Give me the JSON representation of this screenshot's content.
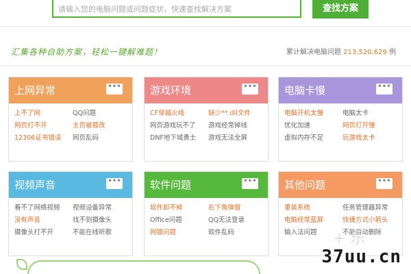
{
  "search": {
    "placeholder": "请输入您的电脑问题或问题症状，快速查找解决方案",
    "button_label": "查找方案"
  },
  "slogan": "汇集各种自助方案，轻松一键解难题！",
  "stats": {
    "prefix": "累计解决电脑问题",
    "count": "213,520,629",
    "suffix": "例"
  },
  "colors": {
    "orange": "#f0a25a",
    "pink": "#ee8787",
    "purple": "#a995dc",
    "blue": "#59b9e0",
    "green": "#55b93c",
    "salmon": "#f49a62",
    "highlight": "#e8702a"
  },
  "cards": [
    {
      "title": "上网异常",
      "more": "•••",
      "rows": [
        [
          {
            "t": "上不了网",
            "h": true
          },
          {
            "t": "QQ问题",
            "h": false
          }
        ],
        [
          {
            "t": "网页打不开",
            "h": true
          },
          {
            "t": "主页被篡改",
            "h": true
          }
        ],
        [
          {
            "t": "12306证书错误",
            "h": true
          },
          {
            "t": "网页乱码",
            "h": false
          }
        ]
      ]
    },
    {
      "title": "游戏环境",
      "more": "•••",
      "rows": [
        [
          {
            "t": "CF穿越火线",
            "h": true
          },
          {
            "t": "缺少**.dll文件",
            "h": true
          }
        ],
        [
          {
            "t": "网页游戏玩不了",
            "h": false
          },
          {
            "t": "游戏经常掉线",
            "h": false
          }
        ],
        [
          {
            "t": "DNF地下城勇士",
            "h": false
          },
          {
            "t": "游戏无法全屏",
            "h": false
          }
        ]
      ]
    },
    {
      "title": "电脑卡慢",
      "more": "•••",
      "rows": [
        [
          {
            "t": "电脑开机太慢",
            "h": true
          },
          {
            "t": "电脑太卡",
            "h": false
          }
        ],
        [
          {
            "t": "优化加速",
            "h": false
          },
          {
            "t": "网页打开慢",
            "h": true
          }
        ],
        [
          {
            "t": "虚拟内存不足",
            "h": false
          },
          {
            "t": "玩游戏太卡",
            "h": true
          }
        ]
      ]
    },
    {
      "title": "视频声音",
      "more": "•••",
      "rows": [
        [
          {
            "t": "看不了网络视频",
            "h": false
          },
          {
            "t": "视频设备异常",
            "h": false
          }
        ],
        [
          {
            "t": "没有声音",
            "h": true
          },
          {
            "t": "找不到摄像头",
            "h": false
          }
        ],
        [
          {
            "t": "摄像头打不开",
            "h": false
          },
          {
            "t": "不能在线听歌",
            "h": false
          }
        ]
      ]
    },
    {
      "title": "软件问题",
      "more": "•••",
      "rows": [
        [
          {
            "t": "软件卸不掉",
            "h": true
          },
          {
            "t": "右下角弹窗",
            "h": true
          }
        ],
        [
          {
            "t": "Office问题",
            "h": false
          },
          {
            "t": "QQ无法登录",
            "h": false
          }
        ],
        [
          {
            "t": "网银问题",
            "h": true
          },
          {
            "t": "软件乱码",
            "h": false
          }
        ]
      ]
    },
    {
      "title": "其他问题",
      "more": "•••",
      "rows": [
        [
          {
            "t": "重装系统",
            "h": true
          },
          {
            "t": "任务管理器异常",
            "h": false
          }
        ],
        [
          {
            "t": "电脑经常蓝屏",
            "h": true
          },
          {
            "t": "快捷方式小箭头",
            "h": true
          }
        ],
        [
          {
            "t": "输入法问题",
            "h": false
          },
          {
            "t": "不能自动删除",
            "h": false
          }
        ]
      ]
    }
  ],
  "watermark": "37uu.cn"
}
